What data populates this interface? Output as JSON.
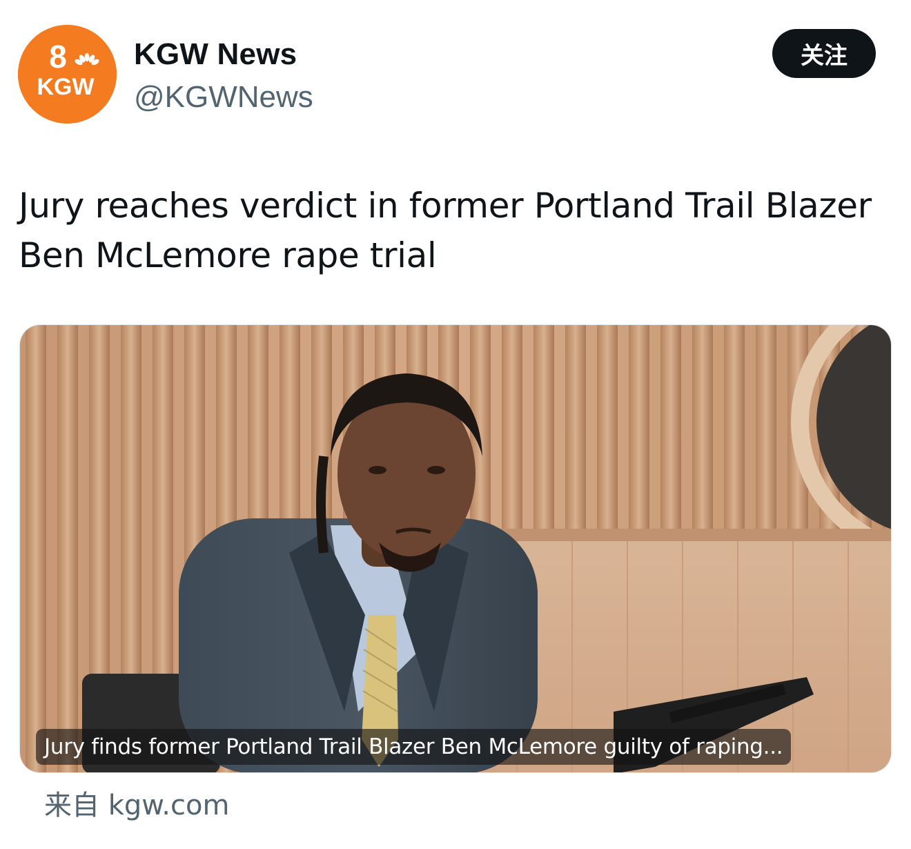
{
  "account": {
    "avatar_lines": [
      "8",
      "KGW"
    ],
    "display_name": "KGW News",
    "handle": "@KGWNews",
    "follow_label": "关注"
  },
  "tweet": {
    "text": "Jury reaches verdict in former Portland Trail Blazer Ben McLemore rape trial"
  },
  "link_card": {
    "caption": "Jury finds former Portland Trail Blazer Ben McLemore guilty of raping...",
    "source": "来自 kgw.com"
  },
  "colors": {
    "brand_orange": "#f47b20",
    "follow_bg": "#0f1419",
    "secondary_text": "#536471"
  }
}
